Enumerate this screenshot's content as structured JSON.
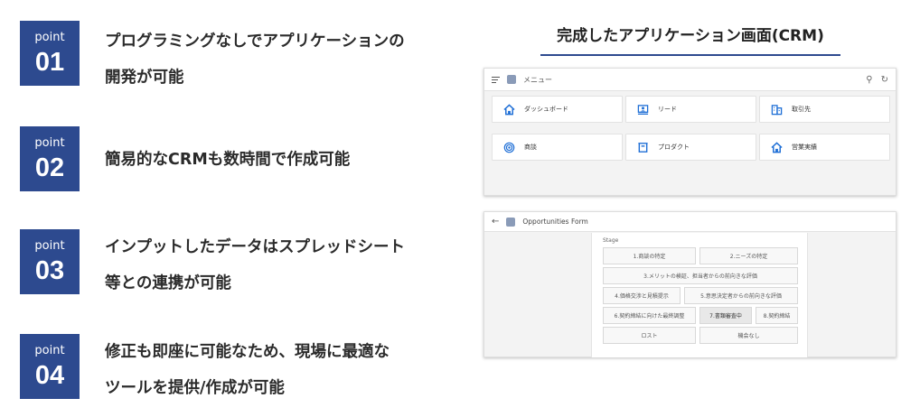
{
  "points": [
    {
      "label": "point",
      "number": "01",
      "lines": [
        "プログラミングなしでアプリケーションの",
        "開発が可能"
      ]
    },
    {
      "label": "point",
      "number": "02",
      "lines": [
        "簡易的なCRMも数時間で作成可能"
      ]
    },
    {
      "label": "point",
      "number": "03",
      "lines": [
        "インプットしたデータはスプレッドシート",
        "等との連携が可能"
      ]
    },
    {
      "label": "point",
      "number": "04",
      "lines": [
        "修正も即座に可能なため、現場に最適な",
        "ツールを提供/作成が可能"
      ]
    }
  ],
  "screen_title": "完成したアプリケーション画面(CRM)",
  "menu_screen": {
    "header_title": "メニュー",
    "tiles": [
      {
        "label": "ダッシュボード",
        "icon": "home-icon"
      },
      {
        "label": "リード",
        "icon": "contact-card-icon"
      },
      {
        "label": "取引先",
        "icon": "building-icon"
      },
      {
        "label": "商談",
        "icon": "target-icon"
      },
      {
        "label": "プロダクト",
        "icon": "box-icon"
      },
      {
        "label": "営業実績",
        "icon": "home-icon"
      }
    ]
  },
  "form_screen": {
    "header_title": "Opportunities Form",
    "stage_label": "Stage",
    "stages": [
      "1.商談の特定",
      "2.ニーズの特定",
      "3.メリットの検証、担当者からの前向きな評価",
      "4.価格交渉と見積提示",
      "5.意思決定者からの前向きな評価",
      "6.契約締結に向けた最終調整",
      "7.書類審査中",
      "8.契約締結",
      "ロスト",
      "機会なし"
    ],
    "selected_stage": "7.書類審査中"
  },
  "colors": {
    "accent": "#2d4a8f",
    "icon_blue": "#1f6fd6"
  }
}
